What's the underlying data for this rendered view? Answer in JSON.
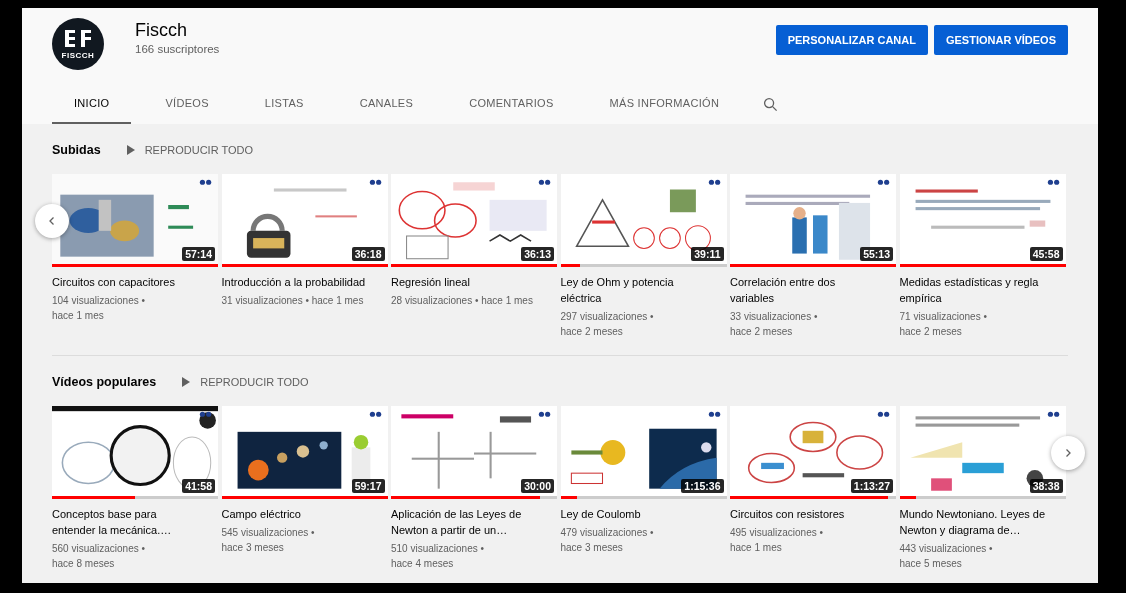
{
  "channel": {
    "logo_text": "FISCCH",
    "name": "Fiscch",
    "subscribers": "166 suscriptores"
  },
  "buttons": [
    "PERSONALIZAR CANAL",
    "GESTIONAR VÍDEOS"
  ],
  "tabs": [
    {
      "label": "INICIO",
      "selected": true
    },
    {
      "label": "VÍDEOS",
      "selected": false
    },
    {
      "label": "LISTAS",
      "selected": false
    },
    {
      "label": "CANALES",
      "selected": false
    },
    {
      "label": "COMENTARIOS",
      "selected": false
    },
    {
      "label": "MÁS INFORMACIÓN",
      "selected": false
    }
  ],
  "sections": [
    {
      "title": "Subidas",
      "play_all": "REPRODUCIR TODO",
      "has_prev": true,
      "has_next": false,
      "divider": true,
      "videos": [
        {
          "duration": "57:14",
          "level": 1,
          "title": "Circuitos con capacitores",
          "views": "104 visualizaciones •",
          "age": "hace 1 mes"
        },
        {
          "duration": "36:18",
          "level": 1,
          "title": "Introducción a la probabilidad",
          "views": "31 visualizaciones •",
          "age": "hace 1 mes"
        },
        {
          "duration": "36:13",
          "level": 1,
          "title": "Regresión lineal",
          "views": "28 visualizaciones •",
          "age": "hace 1 mes"
        },
        {
          "duration": "39:11",
          "level": 0.12,
          "title": "Ley de Ohm y potencia eléctrica",
          "views": "297 visualizaciones •",
          "age": "hace 2 meses"
        },
        {
          "duration": "55:13",
          "level": 1,
          "title": "Correlación entre dos variables",
          "views": "33 visualizaciones •",
          "age": "hace 2 meses"
        },
        {
          "duration": "45:58",
          "level": 1,
          "title": "Medidas estadísticas y regla empírica",
          "views": "71 visualizaciones •",
          "age": "hace 2 meses"
        }
      ]
    },
    {
      "title": "Vídeos populares",
      "play_all": "REPRODUCIR TODO",
      "has_prev": false,
      "has_next": true,
      "divider": false,
      "videos": [
        {
          "duration": "41:58",
          "level": 0.5,
          "title": "Conceptos base para entender la mecánica.…",
          "views": "560 visualizaciones •",
          "age": "hace 8 meses"
        },
        {
          "duration": "59:17",
          "level": 1,
          "title": "Campo eléctrico",
          "views": "545 visualizaciones •",
          "age": "hace 3 meses"
        },
        {
          "duration": "30:00",
          "level": 0.9,
          "title": "Aplicación de las Leyes de Newton a partir de un…",
          "views": "510 visualizaciones •",
          "age": "hace 4 meses"
        },
        {
          "duration": "1:15:36",
          "level": 0.1,
          "title": "Ley de Coulomb",
          "views": "479 visualizaciones •",
          "age": "hace 3 meses"
        },
        {
          "duration": "1:13:27",
          "level": 0.95,
          "title": "Circuitos con resistores",
          "views": "495 visualizaciones •",
          "age": "hace 1 mes"
        },
        {
          "duration": "38:38",
          "level": 0.1,
          "title": "Mundo Newtoniano. Leyes de Newton y diagrama de…",
          "views": "443 visualizaciones •",
          "age": "hace 5 meses"
        }
      ]
    }
  ]
}
